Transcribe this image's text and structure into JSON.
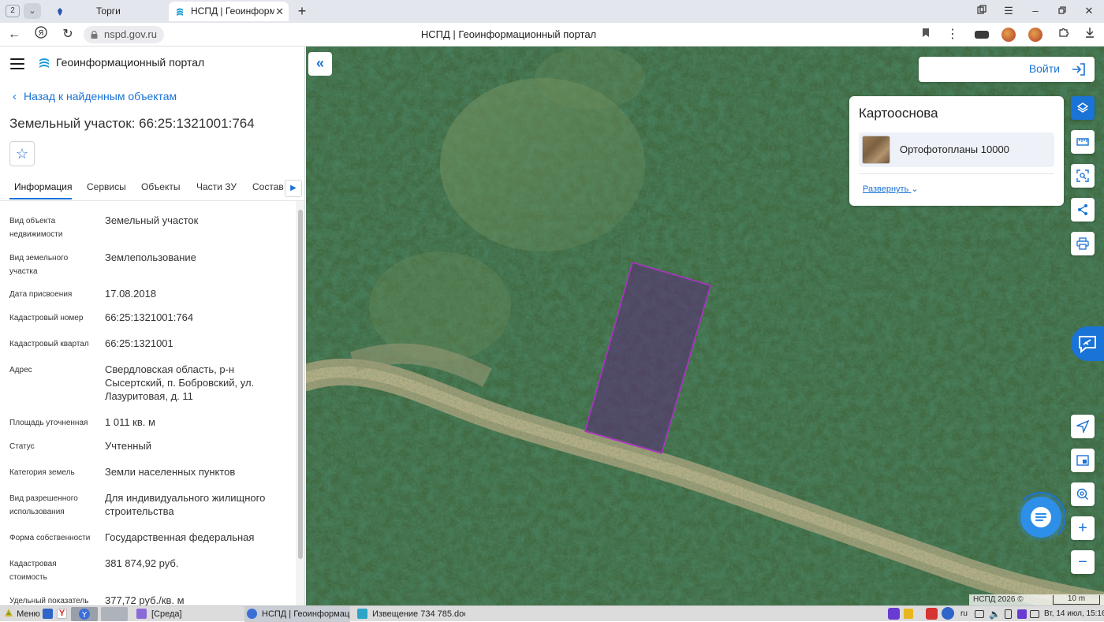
{
  "browser": {
    "tab_count": "2",
    "tabs": [
      {
        "label": "Торги",
        "active": false
      },
      {
        "label": "НСПД | Геоинформаци...",
        "active": true
      }
    ],
    "address": {
      "url": "nspd.gov.ru",
      "title": "НСПД | Геоинформационный портал"
    }
  },
  "sidebar": {
    "brand": "Геоинформационный портал",
    "back_link": "Назад к найденным объектам",
    "object_title": "Земельный участок: 66:25:1321001:764",
    "tabs": [
      "Информация",
      "Сервисы",
      "Объекты",
      "Части ЗУ",
      "Состав"
    ],
    "rows": [
      {
        "label": "Вид объекта недвижимости",
        "value": "Земельный участок"
      },
      {
        "label": "Вид земельного участка",
        "value": "Землепользование"
      },
      {
        "label": "Дата присвоения",
        "value": "17.08.2018"
      },
      {
        "label": "Кадастровый номер",
        "value": "66:25:1321001:764"
      },
      {
        "label": "Кадастровый квартал",
        "value": "66:25:1321001"
      },
      {
        "label": "Адрес",
        "value": "Свердловская область, р-н Сысертский, п. Бобровский, ул. Лазуритовая, д. 11"
      },
      {
        "label": "Площадь уточненная",
        "value": "1 011 кв. м"
      },
      {
        "label": "Статус",
        "value": "Учтенный"
      },
      {
        "label": "Категория земель",
        "value": "Земли населенных пунктов"
      },
      {
        "label": "Вид разрешенного использования",
        "value": "Для индивидуального жилищного строительства"
      },
      {
        "label": "Форма собственности",
        "value": "Государственная федеральная"
      },
      {
        "label": "Кадастровая стоимость",
        "value": "381 874,92 руб."
      },
      {
        "label": "Удельный показатель",
        "value": "377,72 руб./кв. м"
      }
    ]
  },
  "map": {
    "login_label": "Войти",
    "basemap": {
      "title": "Картооснова",
      "selected": "Ортофотопланы 10000",
      "expand_label": "Развернуть"
    },
    "copyright": "НСПД 2026 ©",
    "scale": "10 m",
    "colors": {
      "accent": "#1a73d6",
      "parcel_outline": "#b030c8"
    }
  },
  "taskbar": {
    "menu_label": "Меню",
    "apps": [
      {
        "label": "[Среда]"
      },
      {
        "label": "НСПД | Геоинформаци..."
      },
      {
        "label": "Извещение 734 785.doc..."
      }
    ],
    "lang": "ru",
    "clock": "Вт, 14 июл, 15:16"
  }
}
